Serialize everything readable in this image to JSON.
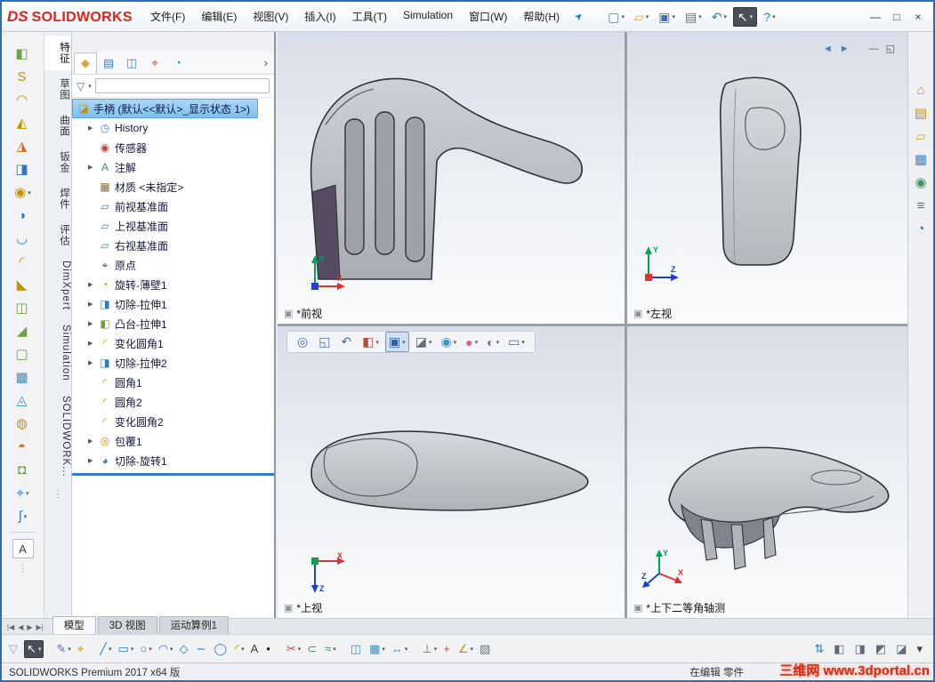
{
  "brand": {
    "mark": "DS",
    "name": "SOLIDWORKS"
  },
  "window_controls": {
    "minimize": "—",
    "maximize": "□",
    "close": "×"
  },
  "menubar": {
    "items": [
      "文件(F)",
      "编辑(E)",
      "视图(V)",
      "插入(I)",
      "工具(T)",
      "Simulation",
      "窗口(W)",
      "帮助(H)"
    ],
    "pin_glyph": "➤"
  },
  "quickbar": [
    {
      "name": "new-document-button",
      "glyph": "▢",
      "color": "#4a7fc1",
      "dd": "▾"
    },
    {
      "name": "open-button",
      "glyph": "▱",
      "color": "#d9a43b",
      "dd": "▾"
    },
    {
      "name": "save-button",
      "glyph": "▣",
      "color": "#3f6fbf",
      "dd": "▾"
    },
    {
      "name": "print-button",
      "glyph": "▤",
      "color": "#66707a",
      "dd": "▾"
    },
    {
      "name": "undo-button",
      "glyph": "↶",
      "color": "#2e79c2",
      "dd": "▾"
    },
    {
      "name": "select-button",
      "glyph": "↖",
      "color": "#ffffff",
      "dd": "▾",
      "state": "pressed"
    },
    {
      "name": "help-button",
      "glyph": "?",
      "color": "#2e79c2",
      "dd": "▾"
    }
  ],
  "doc_controls": [
    {
      "name": "doc-back-button",
      "glyph": "◄",
      "color": "#4a7fc1"
    },
    {
      "name": "doc-forward-button",
      "glyph": "►",
      "color": "#4a7fc1"
    },
    {
      "name": "doc-minimize-button",
      "glyph": "—",
      "color": "#555555"
    },
    {
      "name": "doc-restore-button",
      "glyph": "◱",
      "color": "#555555"
    }
  ],
  "left_toolbar": [
    {
      "name": "extruded-boss-button",
      "glyph": "◧",
      "color": "#6fa243"
    },
    {
      "name": "revolved-boss-button",
      "glyph": "S",
      "color": "#c79100"
    },
    {
      "name": "swept-boss-button",
      "glyph": "◠",
      "color": "#c79100"
    },
    {
      "name": "lofted-boss-button",
      "glyph": "◭",
      "color": "#c79100"
    },
    {
      "name": "boundary-boss-button",
      "glyph": "◮",
      "color": "#d2691e"
    },
    {
      "name": "extruded-cut-button",
      "glyph": "◨",
      "color": "#2e79c2"
    },
    {
      "name": "hole-wizard-button",
      "glyph": "◉",
      "color": "#c79100",
      "dd": "▾"
    },
    {
      "name": "revolved-cut-button",
      "glyph": "◑",
      "color": "#2e79c2"
    },
    {
      "name": "swept-cut-button",
      "glyph": "◡",
      "color": "#2e79c2"
    },
    {
      "name": "fillet-button",
      "glyph": "◜",
      "color": "#c79100"
    },
    {
      "name": "chamfer-button",
      "glyph": "◣",
      "color": "#c79100"
    },
    {
      "name": "rib-button",
      "glyph": "◫",
      "color": "#6fa243"
    },
    {
      "name": "draft-button",
      "glyph": "◢",
      "color": "#6fa243"
    },
    {
      "name": "shell-button",
      "glyph": "▢",
      "color": "#6fa243"
    },
    {
      "name": "linear-pattern-button",
      "glyph": "▦",
      "color": "#3f8fbf"
    },
    {
      "name": "mirror-button",
      "glyph": "◬",
      "color": "#3f8fbf"
    },
    {
      "name": "wrap-button",
      "glyph": "◍",
      "color": "#c79100"
    },
    {
      "name": "dome-button",
      "glyph": "◓",
      "color": "#d2691e"
    },
    {
      "name": "intersect-button",
      "glyph": "◘",
      "color": "#6fa243"
    },
    {
      "name": "reference-geometry-button",
      "glyph": "⌖",
      "color": "#2e79c2",
      "dd": "▾"
    },
    {
      "name": "curves-button",
      "glyph": "∫",
      "color": "#2e79c2",
      "dd": "▾"
    }
  ],
  "annotation_button_glyph": "A",
  "tab_strip": [
    {
      "name": "tab-features",
      "label": "特征",
      "state": "active"
    },
    {
      "name": "tab-sketch",
      "label": "草图"
    },
    {
      "name": "tab-surfaces",
      "label": "曲面"
    },
    {
      "name": "tab-sheet-metal",
      "label": "钣金"
    },
    {
      "name": "tab-weldments",
      "label": "焊件"
    },
    {
      "name": "tab-evaluate",
      "label": "评估"
    },
    {
      "name": "tab-dimxpert",
      "label": "DimXpert"
    },
    {
      "name": "tab-simulation",
      "label": "Simulation"
    },
    {
      "name": "tab-solidworks-addins",
      "label": "SOLIDWORK..."
    }
  ],
  "manager_tabs": [
    {
      "name": "featuremanager-tab",
      "glyph": "◆",
      "color": "#d9a43b",
      "state": "active"
    },
    {
      "name": "propertymanager-tab",
      "glyph": "▤",
      "color": "#4a7fc1"
    },
    {
      "name": "configurationmanager-tab",
      "glyph": "◫",
      "color": "#4a7fc1"
    },
    {
      "name": "dimxpertmanager-tab",
      "glyph": "⌖",
      "color": "#b84c3f"
    },
    {
      "name": "displaymanager-tab",
      "glyph": "◔",
      "color": "#3f8fbf"
    }
  ],
  "manager_overflow_glyph": "›",
  "filter": {
    "funnel_glyph": "▽",
    "dd": "▾"
  },
  "tree": {
    "root": {
      "label": "手柄 (默认<<默认>_显示状态 1>)",
      "glyph": "◪",
      "color": "#c79100"
    },
    "items": [
      {
        "arrow": "▶",
        "glyph": "◷",
        "color": "#4a7fc1",
        "label": "History"
      },
      {
        "arrow": "",
        "glyph": "◉",
        "color": "#b84c3f",
        "label": "传感器"
      },
      {
        "arrow": "▶",
        "glyph": "A",
        "color": "#3f8f5f",
        "label": "注解"
      },
      {
        "arrow": "",
        "glyph": "▦",
        "color": "#8a6d3b",
        "label": "材质 <未指定>"
      },
      {
        "arrow": "",
        "glyph": "▱",
        "color": "#4a7fc1",
        "label": "前视基准面"
      },
      {
        "arrow": "",
        "glyph": "▱",
        "color": "#4a7fc1",
        "label": "上视基准面"
      },
      {
        "arrow": "",
        "glyph": "▱",
        "color": "#4a7fc1",
        "label": "右视基准面"
      },
      {
        "arrow": "",
        "glyph": "⌖",
        "color": "#3a3f44",
        "label": "原点"
      },
      {
        "arrow": "▶",
        "glyph": "◔",
        "color": "#c79100",
        "label": "旋转-薄壁1"
      },
      {
        "arrow": "▶",
        "glyph": "◨",
        "color": "#2e79c2",
        "label": "切除-拉伸1"
      },
      {
        "arrow": "▶",
        "glyph": "◧",
        "color": "#6fa243",
        "label": "凸台-拉伸1"
      },
      {
        "arrow": "▶",
        "glyph": "◜",
        "color": "#c79100",
        "label": "变化圆角1"
      },
      {
        "arrow": "▶",
        "glyph": "◨",
        "color": "#2e79c2",
        "label": "切除-拉伸2"
      },
      {
        "arrow": "",
        "glyph": "◜",
        "color": "#c79100",
        "label": "圆角1"
      },
      {
        "arrow": "",
        "glyph": "◜",
        "color": "#c79100",
        "label": "圆角2"
      },
      {
        "arrow": "",
        "glyph": "◜",
        "color": "#c79100",
        "label": "变化圆角2"
      },
      {
        "arrow": "▶",
        "glyph": "◎",
        "color": "#c79100",
        "label": "包覆1"
      },
      {
        "arrow": "▶",
        "glyph": "◕",
        "color": "#2e79c2",
        "label": "切除-旋转1"
      }
    ]
  },
  "viewports": [
    {
      "label": "*前视"
    },
    {
      "label": "*左视"
    },
    {
      "label": "*上视"
    },
    {
      "label": "*上下二等角轴测"
    }
  ],
  "viewport_label_icon": "▣",
  "triad": {
    "x": "X",
    "y": "Y",
    "z": "Z"
  },
  "headsup": [
    {
      "name": "zoom-fit-button",
      "glyph": "◎",
      "color": "#3f6fbf"
    },
    {
      "name": "zoom-area-button",
      "glyph": "◱",
      "color": "#3f6fbf"
    },
    {
      "name": "previous-view-button",
      "glyph": "↶",
      "color": "#3f6fbf"
    },
    {
      "name": "section-view-button",
      "glyph": "◧",
      "color": "#b84c3f",
      "dd": "▾"
    },
    {
      "name": "view-orientation-button",
      "glyph": "▣",
      "color": "#2e5f9e",
      "dd": "▾",
      "state": "pressed"
    },
    {
      "name": "display-style-button",
      "glyph": "◪",
      "color": "#5f6b77",
      "dd": "▾"
    },
    {
      "name": "hide-show-items-button",
      "glyph": "◉",
      "color": "#3f8fbf",
      "dd": "▾"
    },
    {
      "name": "edit-appearance-button",
      "glyph": "●",
      "color": "#d95f9b",
      "dd": "▾"
    },
    {
      "name": "apply-scene-button",
      "glyph": "◐",
      "color": "#6b7280",
      "dd": "▾"
    },
    {
      "name": "view-settings-button",
      "glyph": "▭",
      "color": "#3f6fbf",
      "dd": "▾"
    }
  ],
  "taskpane": [
    {
      "name": "resources-tab",
      "glyph": "⌂",
      "color": "#d9822b"
    },
    {
      "name": "design-library-tab",
      "glyph": "▤",
      "color": "#c79100"
    },
    {
      "name": "file-explorer-tab",
      "glyph": "▱",
      "color": "#d9a43b"
    },
    {
      "name": "view-palette-tab",
      "glyph": "▦",
      "color": "#4a7fc1"
    },
    {
      "name": "appearances-tab",
      "glyph": "◉",
      "color": "#3f8f5f"
    },
    {
      "name": "custom-properties-tab",
      "glyph": "≡",
      "color": "#5f6b77"
    },
    {
      "name": "forum-tab",
      "glyph": "◔",
      "color": "#2e79c2"
    }
  ],
  "bottom_tabs": {
    "nav": [
      {
        "name": "first-tab-button",
        "glyph": "|◀"
      },
      {
        "name": "prev-tab-button",
        "glyph": "◀"
      },
      {
        "name": "next-tab-button",
        "glyph": "▶"
      },
      {
        "name": "last-tab-button",
        "glyph": "▶|"
      }
    ],
    "tabs": [
      {
        "name": "tab-model",
        "label": "模型",
        "state": "active"
      },
      {
        "name": "tab-3d-views",
        "label": "3D 视图"
      },
      {
        "name": "tab-motion-study",
        "label": "运动算例1"
      }
    ]
  },
  "bottom_toolbar": {
    "items": [
      {
        "name": "selection-filter-button",
        "glyph": "▽",
        "color": "#9aa0a6"
      },
      {
        "name": "select-tool-button",
        "glyph": "↖",
        "color": "#ffffff",
        "dd": "▾",
        "state": "pressed"
      },
      {
        "kind": "sep"
      },
      {
        "name": "sketch-button",
        "glyph": "✎",
        "color": "#3f6fbf",
        "dd": "▾"
      },
      {
        "name": "smart-dimension-button",
        "glyph": "⌖",
        "color": "#c79100"
      },
      {
        "kind": "sep"
      },
      {
        "name": "line-button",
        "glyph": "╱",
        "color": "#2e79c2",
        "dd": "▾"
      },
      {
        "name": "rectangle-button",
        "glyph": "▭",
        "color": "#2e79c2",
        "dd": "▾"
      },
      {
        "name": "circle-button",
        "glyph": "○",
        "color": "#2e79c2",
        "dd": "▾"
      },
      {
        "name": "arc-button",
        "glyph": "◠",
        "color": "#2e79c2",
        "dd": "▾"
      },
      {
        "name": "polygon-button",
        "glyph": "◇",
        "color": "#2e79c2"
      },
      {
        "name": "spline-button",
        "glyph": "∼",
        "color": "#2e79c2"
      },
      {
        "name": "ellipse-button",
        "glyph": "◯",
        "color": "#2e79c2"
      },
      {
        "name": "sketch-fillet-button",
        "glyph": "◜",
        "color": "#c79100",
        "dd": "▾"
      },
      {
        "name": "text-button",
        "glyph": "A",
        "color": "#3a3f44"
      },
      {
        "name": "point-button",
        "glyph": "•",
        "color": "#1a1a1a"
      },
      {
        "kind": "sep"
      },
      {
        "name": "trim-entities-button",
        "glyph": "✂",
        "color": "#b84c3f",
        "dd": "▾"
      },
      {
        "name": "convert-entities-button",
        "glyph": "⊂",
        "color": "#3f8f5f"
      },
      {
        "name": "offset-entities-button",
        "glyph": "≈",
        "color": "#3f8f5f",
        "dd": "▾"
      },
      {
        "kind": "sep"
      },
      {
        "name": "mirror-entities-button",
        "glyph": "◫",
        "color": "#3f8fbf"
      },
      {
        "name": "linear-sketch-pattern-button",
        "glyph": "▦",
        "color": "#3f8fbf",
        "dd": "▾"
      },
      {
        "name": "move-entities-button",
        "glyph": "↔",
        "color": "#3f8fbf",
        "dd": "▾"
      },
      {
        "kind": "sep"
      },
      {
        "name": "display-relations-button",
        "glyph": "⊥",
        "color": "#66707a",
        "dd": "▾"
      },
      {
        "name": "repair-sketch-button",
        "glyph": "+",
        "color": "#b84c3f"
      },
      {
        "name": "quick-snaps-button",
        "glyph": "∠",
        "color": "#c79100",
        "dd": "▾"
      },
      {
        "name": "sketch-picture-button",
        "glyph": "▨",
        "color": "#66707a"
      }
    ],
    "right_items": [
      {
        "name": "rebuild-arrows-button",
        "glyph": "⇅",
        "color": "#2e79c2"
      },
      {
        "name": "view-front-button",
        "glyph": "◧",
        "color": "#5f6b77"
      },
      {
        "name": "view-right-button",
        "glyph": "◨",
        "color": "#5f6b77"
      },
      {
        "name": "view-top-button",
        "glyph": "◩",
        "color": "#5f6b77"
      },
      {
        "name": "view-iso-button",
        "glyph": "◪",
        "color": "#5f6b77"
      },
      {
        "name": "toolbar-options-button",
        "glyph": "▾",
        "color": "#444444"
      }
    ]
  },
  "statusbar": {
    "left": "SOLIDWORKS Premium 2017 x64 版",
    "editing": "在编辑 零件",
    "watermark": "三维网 www.3dportal.cn"
  }
}
